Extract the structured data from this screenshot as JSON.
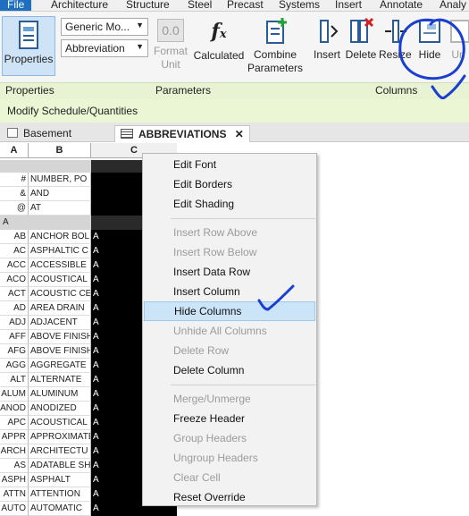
{
  "ribbon_tabs": [
    "File",
    "Architecture",
    "Structure",
    "Steel",
    "Precast",
    "Systems",
    "Insert",
    "Annotate",
    "Analy"
  ],
  "ribbon": {
    "properties_label": "Properties",
    "family_select": "Generic Mo...",
    "text_select": "Abbreviation",
    "format_unit_label": "Format\nUnit",
    "format_unit_value": "0.0",
    "calculated_label": "Calculated",
    "combine_label": "Combine\nParameters",
    "insert_label": "Insert",
    "delete_label": "Delete",
    "resize_label": "Resize",
    "hide_label": "Hide",
    "unhide_label": "Un"
  },
  "panels": {
    "properties": "Properties",
    "parameters": "Parameters",
    "columns": "Columns"
  },
  "context_bar": "Modify Schedule/Quantities",
  "view_tabs": {
    "basement": "Basement",
    "active": "ABBREVIATIONS",
    "close": "✕"
  },
  "columns": {
    "a": "A",
    "b": "B",
    "c": "C"
  },
  "rows": [
    {
      "a": "",
      "b": "",
      "c": "",
      "group": true
    },
    {
      "a": "#",
      "b": "NUMBER, PO",
      "c": ""
    },
    {
      "a": "&",
      "b": "AND",
      "c": ""
    },
    {
      "a": "@",
      "b": "AT",
      "c": ""
    },
    {
      "a": "A",
      "b": "",
      "c": "",
      "group": true,
      "left": true
    },
    {
      "a": "AB",
      "b": "ANCHOR BOL",
      "c": "A"
    },
    {
      "a": "AC",
      "b": "ASPHALTIC C",
      "c": "A"
    },
    {
      "a": "ACC",
      "b": "ACCESSIBLE",
      "c": "A"
    },
    {
      "a": "ACO",
      "b": "ACOUSTICAL",
      "c": "A"
    },
    {
      "a": "ACT",
      "b": "ACOUSTIC CEI",
      "c": "A"
    },
    {
      "a": "AD",
      "b": "AREA DRAIN",
      "c": "A"
    },
    {
      "a": "ADJ",
      "b": "ADJACENT",
      "c": "A"
    },
    {
      "a": "AFF",
      "b": "ABOVE FINISH",
      "c": "A"
    },
    {
      "a": "AFG",
      "b": "ABOVE FINISH",
      "c": "A"
    },
    {
      "a": "AGG",
      "b": "AGGREGATE",
      "c": "A"
    },
    {
      "a": "ALT",
      "b": "ALTERNATE",
      "c": "A"
    },
    {
      "a": "ALUM",
      "b": "ALUMINUM",
      "c": "A"
    },
    {
      "a": "ANOD",
      "b": "ANODIZED",
      "c": "A"
    },
    {
      "a": "APC",
      "b": "ACOUSTICAL",
      "c": "A"
    },
    {
      "a": "APPR",
      "b": "APPROXIMATE",
      "c": "A"
    },
    {
      "a": "ARCH",
      "b": "ARCHITECTU",
      "c": "A"
    },
    {
      "a": "AS",
      "b": "ADATABLE SH",
      "c": "A"
    },
    {
      "a": "ASPH",
      "b": "ASPHALT",
      "c": "A"
    },
    {
      "a": "ATTN",
      "b": "ATTENTION",
      "c": "A"
    },
    {
      "a": "AUTO",
      "b": "AUTOMATIC",
      "c": "A"
    }
  ],
  "menu": [
    {
      "label": "Edit Font",
      "state": "normal"
    },
    {
      "label": "Edit Borders",
      "state": "normal"
    },
    {
      "label": "Edit Shading",
      "state": "normal"
    },
    {
      "sep": true
    },
    {
      "label": "Insert Row Above",
      "state": "disabled"
    },
    {
      "label": "Insert Row Below",
      "state": "disabled"
    },
    {
      "label": "Insert Data Row",
      "state": "normal"
    },
    {
      "label": "Insert Column",
      "state": "normal"
    },
    {
      "label": "Hide Columns",
      "state": "highlight"
    },
    {
      "label": "Unhide All Columns",
      "state": "disabled"
    },
    {
      "label": "Delete Row",
      "state": "disabled"
    },
    {
      "label": "Delete Column",
      "state": "normal"
    },
    {
      "sep": true
    },
    {
      "label": "Merge/Unmerge",
      "state": "disabled"
    },
    {
      "label": "Freeze Header",
      "state": "normal"
    },
    {
      "label": "Group Headers",
      "state": "disabled"
    },
    {
      "label": "Ungroup Headers",
      "state": "disabled"
    },
    {
      "label": "Clear Cell",
      "state": "disabled"
    },
    {
      "label": "Reset Override",
      "state": "normal"
    }
  ],
  "colors": {
    "file_tab": "#1e6fbf",
    "highlight": "#cce4f7",
    "panel_bar": "#e8f3d3",
    "ink": "#1a3fd0"
  }
}
